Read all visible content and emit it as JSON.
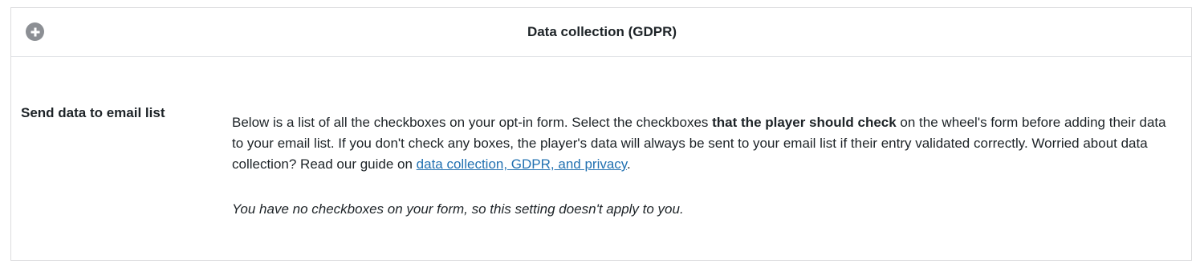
{
  "panel": {
    "title": "Data collection (GDPR)",
    "toggle_icon": "plus-circle-icon"
  },
  "setting": {
    "label": "Send data to email list",
    "description_part1": "Below is a list of all the checkboxes on your opt-in form. Select the checkboxes ",
    "description_bold": "that the player should check",
    "description_part2": " on the wheel's form before adding their data to your email list. If you don't check any boxes, the player's data will always be sent to your email list if their entry validated correctly. Worried about data collection? Read our guide on ",
    "guide_link_text": "data collection, GDPR, and privacy",
    "description_end": ".",
    "note": "You have no checkboxes on your form, so this setting doesn't apply to you."
  },
  "colors": {
    "link": "#2271b1",
    "toggle": "#8c8f94",
    "border": "#dcdcde"
  }
}
